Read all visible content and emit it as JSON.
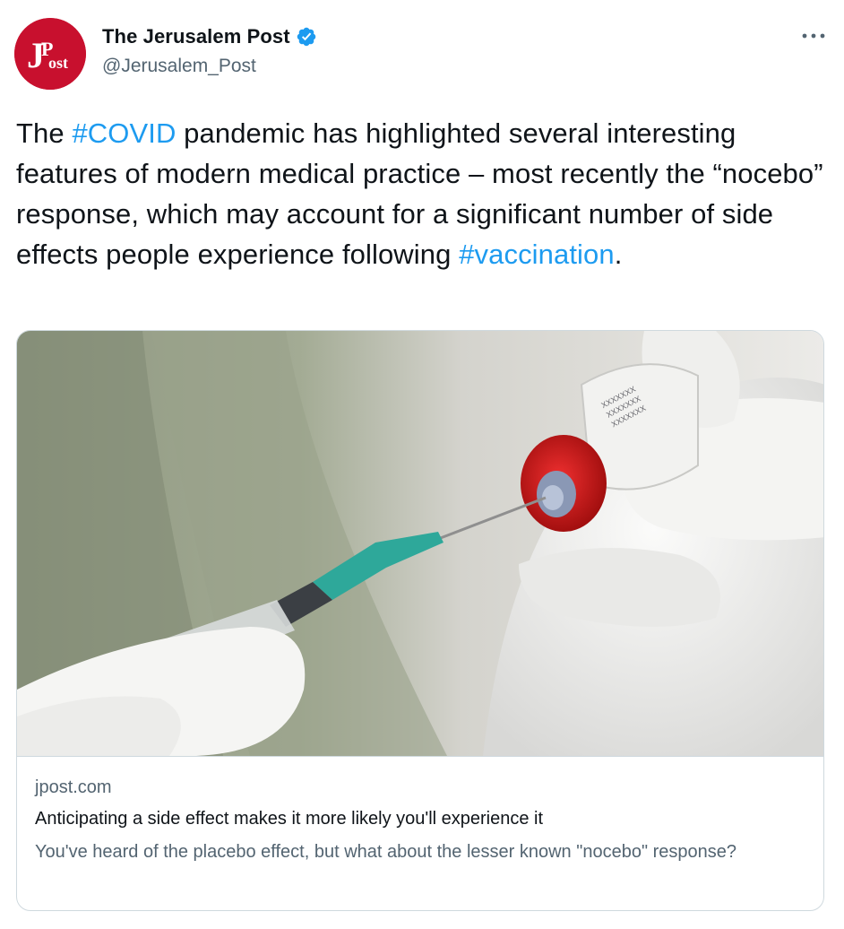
{
  "author": {
    "name": "The Jerusalem Post",
    "handle": "@Jerusalem_Post",
    "verified": true,
    "avatar_text": "JPost"
  },
  "tweet": {
    "part1": "The ",
    "hashtag1": "#COVID",
    "part2": " pandemic has highlighted several interesting features of modern medical practice – most recently the “nocebo” response, which may account for a significant number of side effects people experience following ",
    "hashtag2": "#vaccination",
    "part3": "."
  },
  "card": {
    "domain": "jpost.com",
    "title": "Anticipating a side effect makes it more likely you'll experience it",
    "description": "You've heard of the placebo effect, but what about the lesser known \"nocebo\" response?"
  },
  "icons": {
    "more": "more-horizontal-icon",
    "verified": "verified-badge-icon"
  },
  "colors": {
    "accent": "#1d9bf0",
    "brand_red": "#c8102e"
  }
}
